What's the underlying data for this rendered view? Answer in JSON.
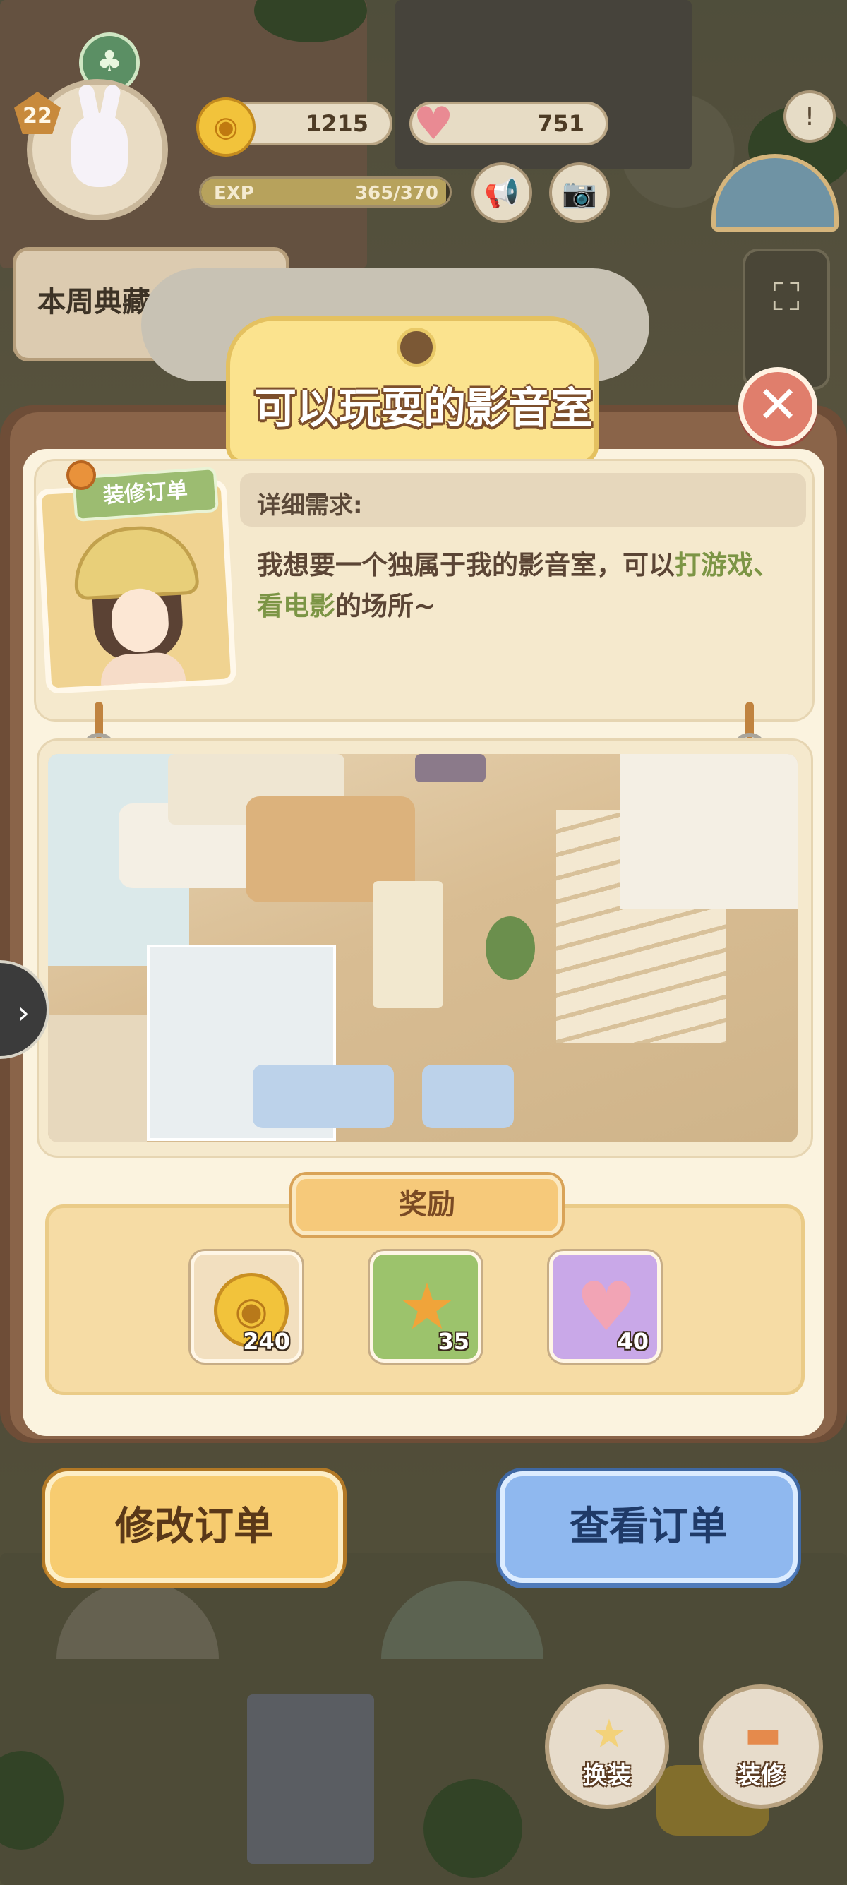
{
  "hud": {
    "level": "22",
    "coins": "1215",
    "hearts": "751",
    "exp_label": "EXP",
    "exp_value": "365/370",
    "exp_progress": 0.986,
    "weekly_label": "本周典藏"
  },
  "modal": {
    "title": "可以玩耍的影音室",
    "tag_label": "装修订单",
    "requirement_heading": "详细需求:",
    "requirement_text_plain": "我想要一个独属于我的影音室，可以",
    "requirement_text_highlight1": "打游戏",
    "requirement_text_sep": "、",
    "requirement_text_highlight2": "看电影",
    "requirement_text_end": "的场所~",
    "reward_heading": "奖励",
    "rewards": [
      {
        "type": "coin",
        "icon": "coin-icon",
        "qty": "240"
      },
      {
        "type": "star",
        "icon": "star-icon",
        "qty": "35"
      },
      {
        "type": "heart",
        "icon": "heart-icon",
        "qty": "40"
      }
    ]
  },
  "actions": {
    "edit_order": "修改订单",
    "view_order": "查看订单"
  },
  "bottom_bar": {
    "outfit": "换装",
    "decorate": "装修"
  },
  "colors": {
    "highlight_green": "#7c9545",
    "edit_button": "#f7cc70",
    "view_button": "#8fb8ef",
    "close_button": "#e07e6c"
  }
}
